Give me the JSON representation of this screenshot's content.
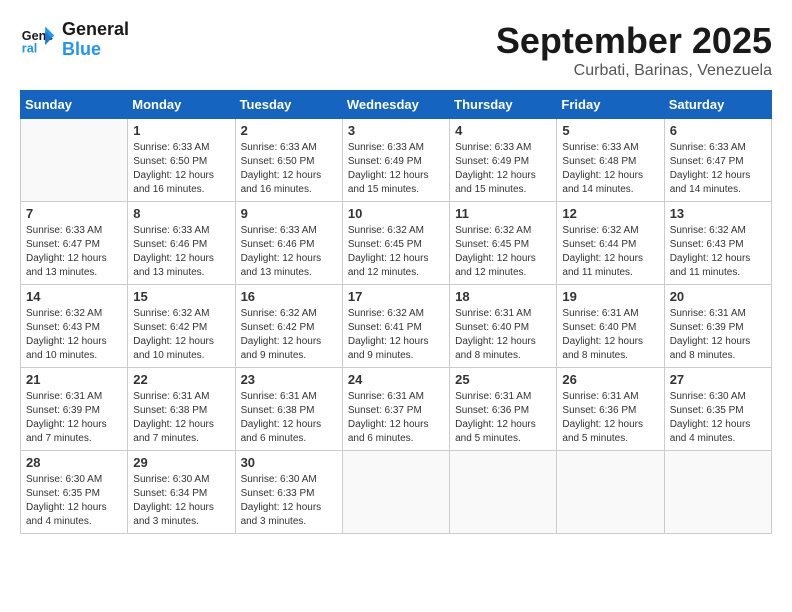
{
  "header": {
    "logo_line1": "General",
    "logo_line2": "Blue",
    "month": "September 2025",
    "location": "Curbati, Barinas, Venezuela"
  },
  "days_of_week": [
    "Sunday",
    "Monday",
    "Tuesday",
    "Wednesday",
    "Thursday",
    "Friday",
    "Saturday"
  ],
  "weeks": [
    [
      {
        "day": "",
        "info": ""
      },
      {
        "day": "1",
        "info": "Sunrise: 6:33 AM\nSunset: 6:50 PM\nDaylight: 12 hours\nand 16 minutes."
      },
      {
        "day": "2",
        "info": "Sunrise: 6:33 AM\nSunset: 6:50 PM\nDaylight: 12 hours\nand 16 minutes."
      },
      {
        "day": "3",
        "info": "Sunrise: 6:33 AM\nSunset: 6:49 PM\nDaylight: 12 hours\nand 15 minutes."
      },
      {
        "day": "4",
        "info": "Sunrise: 6:33 AM\nSunset: 6:49 PM\nDaylight: 12 hours\nand 15 minutes."
      },
      {
        "day": "5",
        "info": "Sunrise: 6:33 AM\nSunset: 6:48 PM\nDaylight: 12 hours\nand 14 minutes."
      },
      {
        "day": "6",
        "info": "Sunrise: 6:33 AM\nSunset: 6:47 PM\nDaylight: 12 hours\nand 14 minutes."
      }
    ],
    [
      {
        "day": "7",
        "info": "Sunrise: 6:33 AM\nSunset: 6:47 PM\nDaylight: 12 hours\nand 13 minutes."
      },
      {
        "day": "8",
        "info": "Sunrise: 6:33 AM\nSunset: 6:46 PM\nDaylight: 12 hours\nand 13 minutes."
      },
      {
        "day": "9",
        "info": "Sunrise: 6:33 AM\nSunset: 6:46 PM\nDaylight: 12 hours\nand 13 minutes."
      },
      {
        "day": "10",
        "info": "Sunrise: 6:32 AM\nSunset: 6:45 PM\nDaylight: 12 hours\nand 12 minutes."
      },
      {
        "day": "11",
        "info": "Sunrise: 6:32 AM\nSunset: 6:45 PM\nDaylight: 12 hours\nand 12 minutes."
      },
      {
        "day": "12",
        "info": "Sunrise: 6:32 AM\nSunset: 6:44 PM\nDaylight: 12 hours\nand 11 minutes."
      },
      {
        "day": "13",
        "info": "Sunrise: 6:32 AM\nSunset: 6:43 PM\nDaylight: 12 hours\nand 11 minutes."
      }
    ],
    [
      {
        "day": "14",
        "info": "Sunrise: 6:32 AM\nSunset: 6:43 PM\nDaylight: 12 hours\nand 10 minutes."
      },
      {
        "day": "15",
        "info": "Sunrise: 6:32 AM\nSunset: 6:42 PM\nDaylight: 12 hours\nand 10 minutes."
      },
      {
        "day": "16",
        "info": "Sunrise: 6:32 AM\nSunset: 6:42 PM\nDaylight: 12 hours\nand 9 minutes."
      },
      {
        "day": "17",
        "info": "Sunrise: 6:32 AM\nSunset: 6:41 PM\nDaylight: 12 hours\nand 9 minutes."
      },
      {
        "day": "18",
        "info": "Sunrise: 6:31 AM\nSunset: 6:40 PM\nDaylight: 12 hours\nand 8 minutes."
      },
      {
        "day": "19",
        "info": "Sunrise: 6:31 AM\nSunset: 6:40 PM\nDaylight: 12 hours\nand 8 minutes."
      },
      {
        "day": "20",
        "info": "Sunrise: 6:31 AM\nSunset: 6:39 PM\nDaylight: 12 hours\nand 8 minutes."
      }
    ],
    [
      {
        "day": "21",
        "info": "Sunrise: 6:31 AM\nSunset: 6:39 PM\nDaylight: 12 hours\nand 7 minutes."
      },
      {
        "day": "22",
        "info": "Sunrise: 6:31 AM\nSunset: 6:38 PM\nDaylight: 12 hours\nand 7 minutes."
      },
      {
        "day": "23",
        "info": "Sunrise: 6:31 AM\nSunset: 6:38 PM\nDaylight: 12 hours\nand 6 minutes."
      },
      {
        "day": "24",
        "info": "Sunrise: 6:31 AM\nSunset: 6:37 PM\nDaylight: 12 hours\nand 6 minutes."
      },
      {
        "day": "25",
        "info": "Sunrise: 6:31 AM\nSunset: 6:36 PM\nDaylight: 12 hours\nand 5 minutes."
      },
      {
        "day": "26",
        "info": "Sunrise: 6:31 AM\nSunset: 6:36 PM\nDaylight: 12 hours\nand 5 minutes."
      },
      {
        "day": "27",
        "info": "Sunrise: 6:30 AM\nSunset: 6:35 PM\nDaylight: 12 hours\nand 4 minutes."
      }
    ],
    [
      {
        "day": "28",
        "info": "Sunrise: 6:30 AM\nSunset: 6:35 PM\nDaylight: 12 hours\nand 4 minutes."
      },
      {
        "day": "29",
        "info": "Sunrise: 6:30 AM\nSunset: 6:34 PM\nDaylight: 12 hours\nand 3 minutes."
      },
      {
        "day": "30",
        "info": "Sunrise: 6:30 AM\nSunset: 6:33 PM\nDaylight: 12 hours\nand 3 minutes."
      },
      {
        "day": "",
        "info": ""
      },
      {
        "day": "",
        "info": ""
      },
      {
        "day": "",
        "info": ""
      },
      {
        "day": "",
        "info": ""
      }
    ]
  ]
}
